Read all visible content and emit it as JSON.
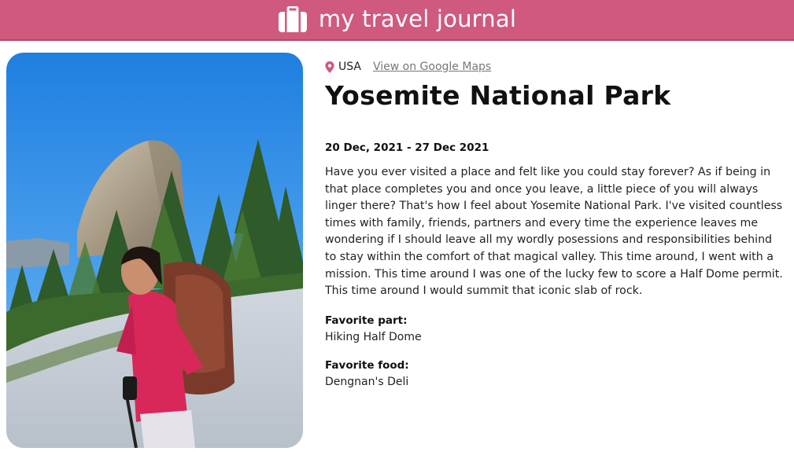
{
  "header": {
    "title": "my travel journal",
    "icon": "suitcase-icon",
    "background_color": "#cf5a7d"
  },
  "entry": {
    "location": {
      "icon": "map-pin-icon",
      "country": "USA",
      "maps_link_label": "View on Google Maps"
    },
    "title": "Yosemite National Park",
    "dates": "20 Dec, 2021 - 27 Dec 2021",
    "description": "Have you ever visited a place and felt like you could stay forever? As if being in that place completes you and once you leave, a little piece of you will always linger there? That's how I feel about Yosemite National Park. I've visited countless times with family, friends, partners and every time the experience leaves me wondering if I should leave all my wordly posessions and responsibilities behind to stay within the comfort of that magical valley. This time around, I went with a mission. This time around I was one of the lucky few to score a Half Dome permit. This time around I would summit that iconic slab of rock.",
    "favorite_part_label": "Favorite part:",
    "favorite_part": "Hiking Half Dome",
    "favorite_food_label": "Favorite food:",
    "favorite_food": "Dengnan's Deli"
  }
}
